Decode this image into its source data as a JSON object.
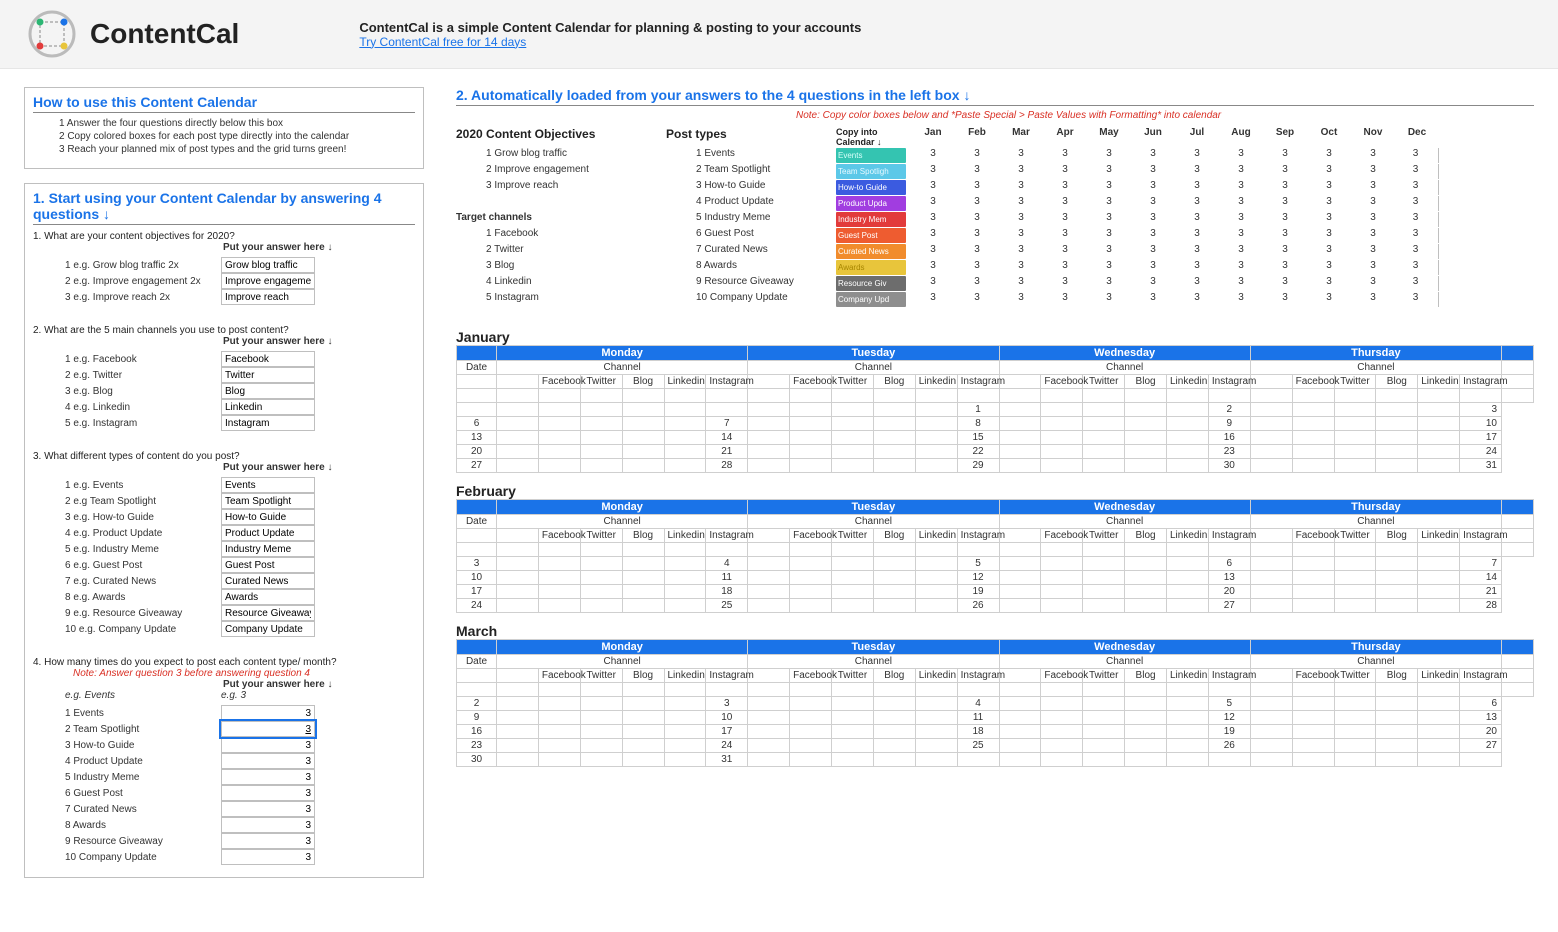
{
  "topbar": {
    "logo_text": "ContentCal",
    "desc": "ContentCal is a simple Content Calendar for planning & posting to your accounts",
    "link": "Try ContentCal free for 14 days"
  },
  "howto": {
    "title": "How to use this Content Calendar",
    "step1": "1  Answer the four questions directly below this box",
    "step2": "2  Copy colored boxes for each post type directly into the calendar",
    "step3": "3  Reach your planned mix of post types and the grid turns green!"
  },
  "section1": {
    "title": "1. Start using your Content Calendar by answering 4 questions ↓",
    "q1": "1. What are your content objectives for 2020?",
    "answer_header": "Put your answer here ↓",
    "q1items": [
      {
        "n": "1",
        "eg": "e.g. Grow blog traffic 2x",
        "val": "Grow blog traffic"
      },
      {
        "n": "2",
        "eg": "e.g. Improve engagement 2x",
        "val": "Improve engagement"
      },
      {
        "n": "3",
        "eg": "e.g. Improve reach 2x",
        "val": "Improve reach"
      }
    ],
    "q2": "2. What are the 5 main channels you use to post content?",
    "q2items": [
      {
        "n": "1",
        "eg": "e.g. Facebook",
        "val": "Facebook"
      },
      {
        "n": "2",
        "eg": "e.g. Twitter",
        "val": "Twitter"
      },
      {
        "n": "3",
        "eg": "e.g. Blog",
        "val": "Blog"
      },
      {
        "n": "4",
        "eg": "e.g. Linkedin",
        "val": "Linkedin"
      },
      {
        "n": "5",
        "eg": "e.g. Instagram",
        "val": "Instagram"
      }
    ],
    "q3": "3. What different types of content do you post?",
    "q3items": [
      {
        "n": "1",
        "eg": "e.g. Events",
        "val": "Events"
      },
      {
        "n": "2",
        "eg": "e.g Team Spotlight",
        "val": "Team Spotlight"
      },
      {
        "n": "3",
        "eg": "e.g. How-to Guide",
        "val": "How-to Guide"
      },
      {
        "n": "4",
        "eg": "e.g. Product Update",
        "val": "Product Update"
      },
      {
        "n": "5",
        "eg": "e.g. Industry Meme",
        "val": "Industry Meme"
      },
      {
        "n": "6",
        "eg": "e.g. Guest Post",
        "val": "Guest Post"
      },
      {
        "n": "7",
        "eg": "e.g. Curated News",
        "val": "Curated News"
      },
      {
        "n": "8",
        "eg": "e.g. Awards",
        "val": "Awards"
      },
      {
        "n": "9",
        "eg": "e.g. Resource Giveaway",
        "val": "Resource Giveaway"
      },
      {
        "n": "10",
        "eg": "e.g. Company Update",
        "val": "Company Update"
      }
    ],
    "q4": "4. How many times do you expect to post each content type/ month?",
    "q4note": "Note: Answer question 3 before answering question 4",
    "q4eg_label": "e.g. Events",
    "q4eg_val": "e.g. 3",
    "q4items": [
      {
        "n": "1",
        "label": "Events",
        "val": "3"
      },
      {
        "n": "2",
        "label": "Team Spotlight",
        "val": "3"
      },
      {
        "n": "3",
        "label": "How-to Guide",
        "val": "3"
      },
      {
        "n": "4",
        "label": "Product Update",
        "val": "3"
      },
      {
        "n": "5",
        "label": "Industry Meme",
        "val": "3"
      },
      {
        "n": "6",
        "label": "Guest Post",
        "val": "3"
      },
      {
        "n": "7",
        "label": "Curated News",
        "val": "3"
      },
      {
        "n": "8",
        "label": "Awards",
        "val": "3"
      },
      {
        "n": "9",
        "label": "Resource Giveaway",
        "val": "3"
      },
      {
        "n": "10",
        "label": "Company Update",
        "val": "3"
      }
    ]
  },
  "section2": {
    "title": "2. Automatically loaded from your answers to the 4 questions in the left box ↓",
    "note": "Note: Copy color boxes below and *Paste Special > Paste Values with Formatting* into calendar",
    "hdr_obj": "2020 Content Objectives",
    "hdr_pt": "Post types",
    "hdr_copy": "Copy into Calendar ↓",
    "months": [
      "Jan",
      "Feb",
      "Mar",
      "Apr",
      "May",
      "Jun",
      "Jul",
      "Aug",
      "Sep",
      "Oct",
      "Nov",
      "Dec"
    ],
    "objectives": [
      "1  Grow blog traffic",
      "2  Improve engagement",
      "3  Improve reach",
      "",
      "Target channels",
      "1  Facebook",
      "2  Twitter",
      "3  Blog",
      "4  Linkedin",
      "5  Instagram"
    ],
    "post_types": [
      {
        "n": "1",
        "label": "Events",
        "chip": "chip-events",
        "chip_label": "Events"
      },
      {
        "n": "2",
        "label": "Team Spotlight",
        "chip": "chip-team",
        "chip_label": "Team Spotligh"
      },
      {
        "n": "3",
        "label": "How-to Guide",
        "chip": "chip-howto",
        "chip_label": "How-to Guide"
      },
      {
        "n": "4",
        "label": "Product Update",
        "chip": "chip-product",
        "chip_label": "Product Upda"
      },
      {
        "n": "5",
        "label": "Industry Meme",
        "chip": "chip-meme",
        "chip_label": "Industry Mem"
      },
      {
        "n": "6",
        "label": "Guest Post",
        "chip": "chip-guest",
        "chip_label": "Guest Post"
      },
      {
        "n": "7",
        "label": "Curated News",
        "chip": "chip-curated",
        "chip_label": "Curated News"
      },
      {
        "n": "8",
        "label": "Awards",
        "chip": "chip-awards",
        "chip_label": "Awards"
      },
      {
        "n": "9",
        "label": "Resource Giveaway",
        "chip": "chip-resource",
        "chip_label": "Resource Giv"
      },
      {
        "n": "10",
        "label": "Company Update",
        "chip": "chip-company",
        "chip_label": "Company Upd"
      }
    ],
    "target_value": "3"
  },
  "calendar": {
    "days": [
      "Monday",
      "Tuesday",
      "Wednesday",
      "Thursday"
    ],
    "date_label": "Date",
    "channel_label": "Channel",
    "channels": [
      "Facebook",
      "Twitter",
      "Blog",
      "Linkedin",
      "Instagram"
    ],
    "months": [
      {
        "name": "January",
        "weeks": [
          {
            "mon": "",
            "tue": "",
            "wed": "1",
            "thu": "2",
            "end": "3"
          },
          {
            "mon": "6",
            "tue": "7",
            "wed": "8",
            "thu": "9",
            "end": "10"
          },
          {
            "mon": "13",
            "tue": "14",
            "wed": "15",
            "thu": "16",
            "end": "17"
          },
          {
            "mon": "20",
            "tue": "21",
            "wed": "22",
            "thu": "23",
            "end": "24"
          },
          {
            "mon": "27",
            "tue": "28",
            "wed": "29",
            "thu": "30",
            "end": "31"
          }
        ]
      },
      {
        "name": "February",
        "weeks": [
          {
            "mon": "3",
            "tue": "4",
            "wed": "5",
            "thu": "6",
            "end": "7"
          },
          {
            "mon": "10",
            "tue": "11",
            "wed": "12",
            "thu": "13",
            "end": "14"
          },
          {
            "mon": "17",
            "tue": "18",
            "wed": "19",
            "thu": "20",
            "end": "21"
          },
          {
            "mon": "24",
            "tue": "25",
            "wed": "26",
            "thu": "27",
            "end": "28"
          }
        ]
      },
      {
        "name": "March",
        "weeks": [
          {
            "mon": "2",
            "tue": "3",
            "wed": "4",
            "thu": "5",
            "end": "6"
          },
          {
            "mon": "9",
            "tue": "10",
            "wed": "11",
            "thu": "12",
            "end": "13"
          },
          {
            "mon": "16",
            "tue": "17",
            "wed": "18",
            "thu": "19",
            "end": "20"
          },
          {
            "mon": "23",
            "tue": "24",
            "wed": "25",
            "thu": "26",
            "end": "27"
          },
          {
            "mon": "30",
            "tue": "31",
            "wed": "",
            "thu": "",
            "end": ""
          }
        ]
      }
    ]
  }
}
